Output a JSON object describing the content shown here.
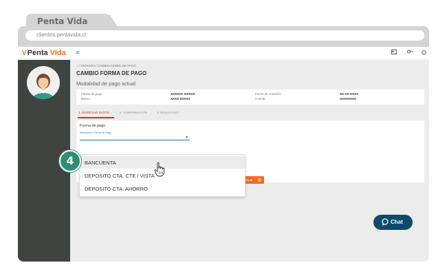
{
  "browser": {
    "tab_title": "Penta Vida",
    "url": "clientes.pentavida.cl"
  },
  "header": {
    "logo_part1": "Penta",
    "logo_part2": "Vida",
    "logo_mark": "V"
  },
  "breadcrumb": "/ PENSIÓN / CAMBIO FORMA DE PAGO",
  "page_title": "CAMBIO FORMA DE PAGO",
  "section_title": "Modalidad de pago actual",
  "summary": {
    "labels_left": [
      "Forma de pago",
      "Banco"
    ],
    "values_left": [
      "XXXXXX XX/XXX",
      "XXXX XXXXX"
    ],
    "labels_right": [
      "Fecha de creación",
      "Cuenta"
    ],
    "values_right": [
      "XX-XX-XXXX",
      "XXXXXXXX"
    ]
  },
  "steps": [
    {
      "label": "1. INGRESAR DATOS",
      "active": true
    },
    {
      "label": "2. CONFIRMACIÓN",
      "active": false
    },
    {
      "label": "3. RESULTADO",
      "active": false
    }
  ],
  "form": {
    "label": "Forma de pago",
    "select_hint": "Seleccione Forma de Pago"
  },
  "continue_button": "ntinuar",
  "dropdown_options": [
    "BANCUENTA",
    "DEPOSITO CTA. CTE / VISTA",
    "DEPOSITO CTA. AHORRO"
  ],
  "step_badge": "4",
  "chat_label": "Chat",
  "colors": {
    "accent_orange": "#f26b21",
    "sidebar": "#3f4441",
    "badge": "#2f8d75",
    "chat": "#0e4a6b"
  }
}
